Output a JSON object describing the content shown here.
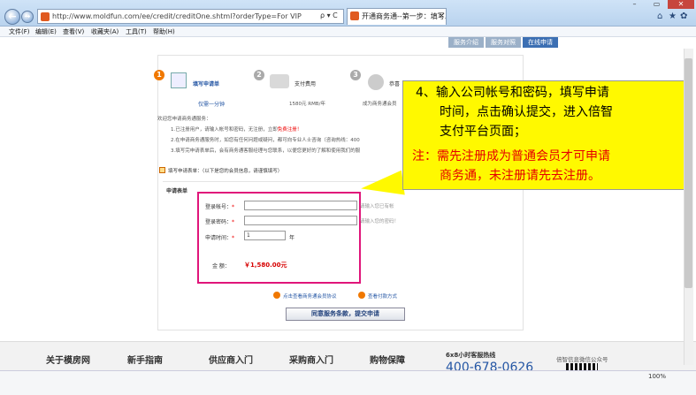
{
  "browser": {
    "url": "http://www.moldfun.com/ee/credit/creditOne.shtml?orderType=For VIP",
    "search_hint": "ρ ▾ C",
    "tab_title": "开通商务通--第一步：填写...",
    "tab_close": "×",
    "win_controls": [
      "–",
      "▭",
      "✕"
    ],
    "toolbar_icons": [
      "⌂",
      "★",
      "✿"
    ]
  },
  "menubar": [
    "文件(F)",
    "编辑(E)",
    "查看(V)",
    "收藏夹(A)",
    "工具(T)",
    "帮助(H)"
  ],
  "topnav": [
    "服务介绍",
    "服务对照",
    "在线申请"
  ],
  "steps": [
    {
      "num": "1",
      "title": "填写申请单",
      "sub": "仅需一分钟",
      "color": "#f07800"
    },
    {
      "num": "2",
      "title": "支付费用",
      "sub": "1580元 RMB/年",
      "color": "#aaaaaa"
    },
    {
      "num": "3",
      "title": "恭喜",
      "sub": "成为商务通会员",
      "color": "#aaaaaa"
    }
  ],
  "intro": {
    "title": "欢迎您申请商务通服务：",
    "line1": "1.已注册用户，请输入帐号和密码，无注册，立即",
    "line1_link": "免费注册！",
    "line2": "2.在申请商务通服务时，如您有任何问题或疑问，都可向专业人士咨询（咨询热线：400",
    "line3": "3.填写完申请表单后，会有商务通客服经理与您联系，以便您更好的了解和使用我们的服"
  },
  "form_hint": "填写申请表单：（以下是您的会员信息，请谨慎填写）",
  "form_section": "申请表单",
  "form": {
    "account_label": "登录帐号：",
    "account_hint": "请输入您已有帐",
    "password_label": "登录密码：",
    "password_hint": "请输入您的密码！",
    "duration_label": "申请时间：",
    "duration_value": "1",
    "duration_unit": "年",
    "required_mark": "*",
    "fee_label": "金  额：",
    "fee_value": "￥1,580.00元"
  },
  "links": {
    "agreement": "点击查看商务通会员协议",
    "payment": "查看付款方式"
  },
  "submit_label": "同意服务条款，提交申请",
  "callout": {
    "line1": "4、输入公司帐号和密码，填写申请",
    "line2": "时间，点击确认提交，进入倍智",
    "line3": "支付平台页面；",
    "note1": "注：需先注册成为普通会员才可申请",
    "note2": "商务通，未注册请先去注册。"
  },
  "footer": {
    "nav": [
      "关于模房网",
      "新手指南",
      "供应商入门",
      "采购商入门",
      "购物保障"
    ],
    "hotline_label": "6x8小时客服热线",
    "hotline": "400-678-0626",
    "wechat": "倍智信息微信公众号"
  },
  "statusbar": {
    "zoom": "100%"
  }
}
